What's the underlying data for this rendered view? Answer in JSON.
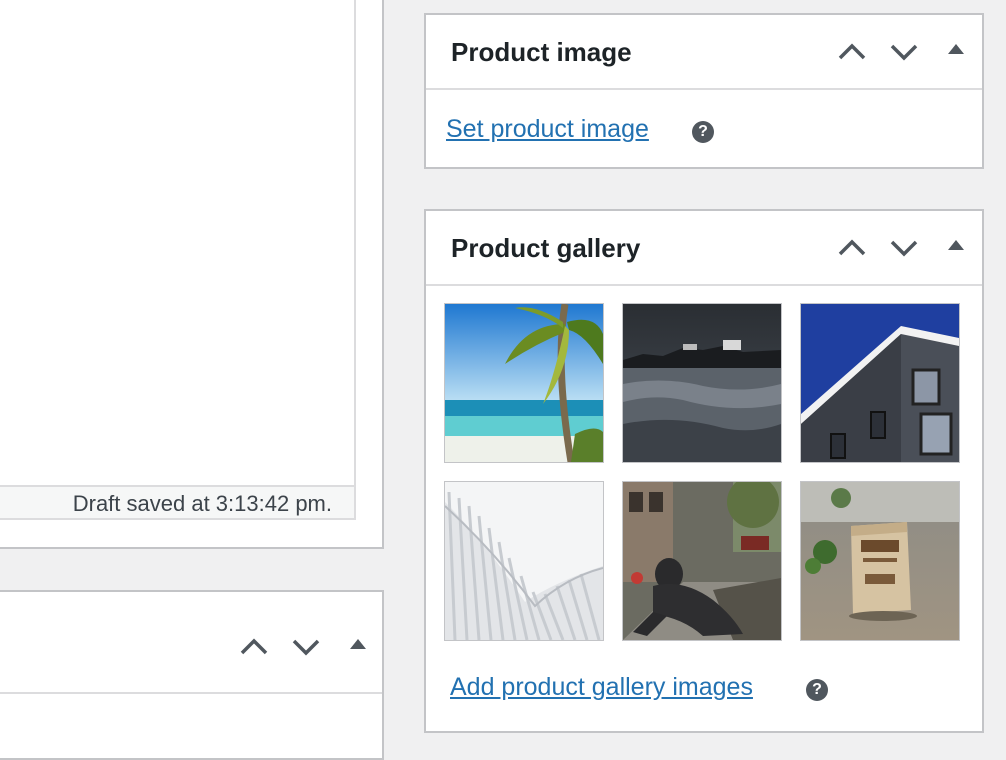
{
  "editor": {
    "status": "Draft saved at 3:13:42 pm."
  },
  "product_image": {
    "title": "Product image",
    "set_link": "Set product image",
    "help": "?"
  },
  "product_gallery": {
    "title": "Product gallery",
    "add_link": "Add product gallery images",
    "help": "?",
    "images": [
      {
        "name": "tropical-beach-palm"
      },
      {
        "name": "misty-rocky-coast"
      },
      {
        "name": "modern-building-facade"
      },
      {
        "name": "white-architecture-curve"
      },
      {
        "name": "bear-statue-street"
      },
      {
        "name": "coffee-beans-bag"
      }
    ]
  },
  "icons": {
    "move_up": "chevron-up-icon",
    "move_down": "chevron-down-icon",
    "toggle": "triangle-up-icon"
  }
}
